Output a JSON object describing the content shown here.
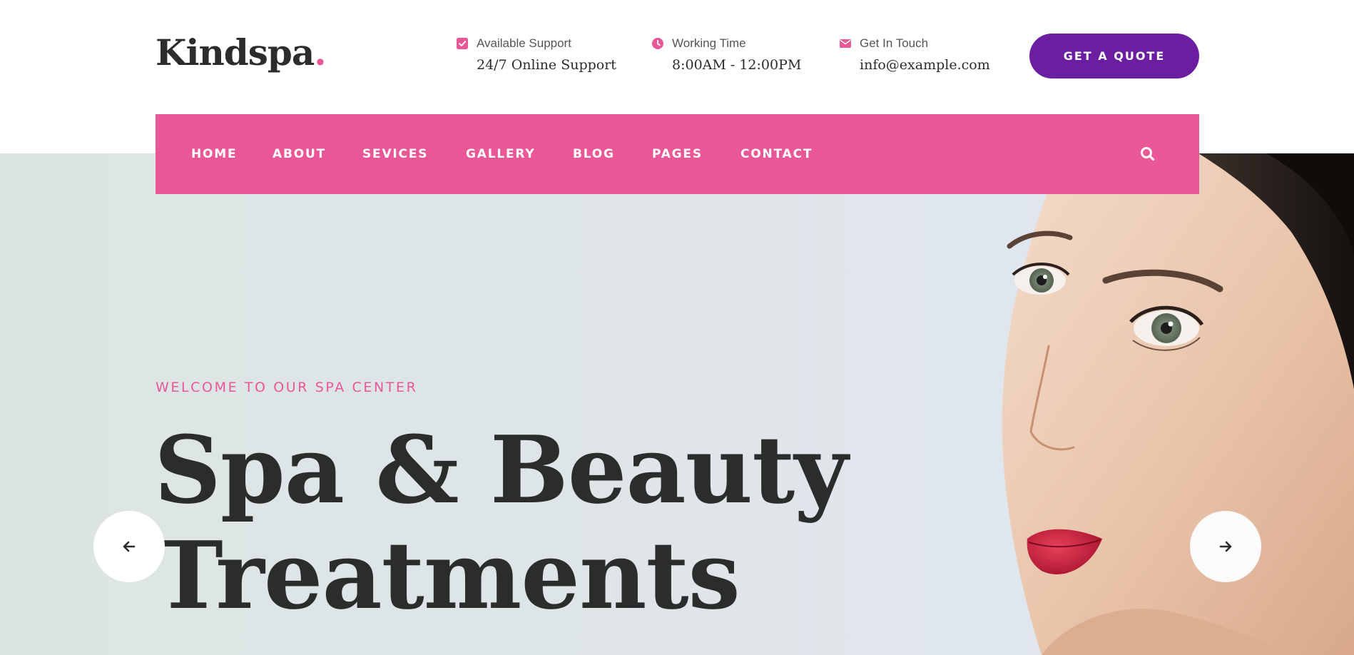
{
  "brand": {
    "name": "Kindspa",
    "dot": "."
  },
  "header": {
    "support": {
      "label": "Available Support",
      "value": "24/7 Online Support",
      "icon": "check-square-icon"
    },
    "hours": {
      "label": "Working Time",
      "value": "8:00AM - 12:00PM",
      "icon": "clock-icon"
    },
    "contact": {
      "label": "Get In Touch",
      "value": "info@example.com",
      "icon": "envelope-icon"
    },
    "cta": "GET A QUOTE"
  },
  "nav": {
    "items": [
      {
        "label": "HOME"
      },
      {
        "label": "ABOUT"
      },
      {
        "label": "SEVICES"
      },
      {
        "label": "GALLERY"
      },
      {
        "label": "BLOG"
      },
      {
        "label": "PAGES"
      },
      {
        "label": "CONTACT"
      }
    ],
    "search_icon": "search-icon"
  },
  "hero": {
    "subtitle": "WELCOME TO OUR SPA CENTER",
    "title_line1": "Spa & Beauty",
    "title_line2": "Treatments",
    "prev_icon": "arrow-left-icon",
    "next_icon": "arrow-right-icon"
  },
  "colors": {
    "accent_pink": "#ea5797",
    "accent_purple": "#6b1fa0",
    "text_dark": "#2b2d2c",
    "hero_bg": "#dde5e4"
  }
}
